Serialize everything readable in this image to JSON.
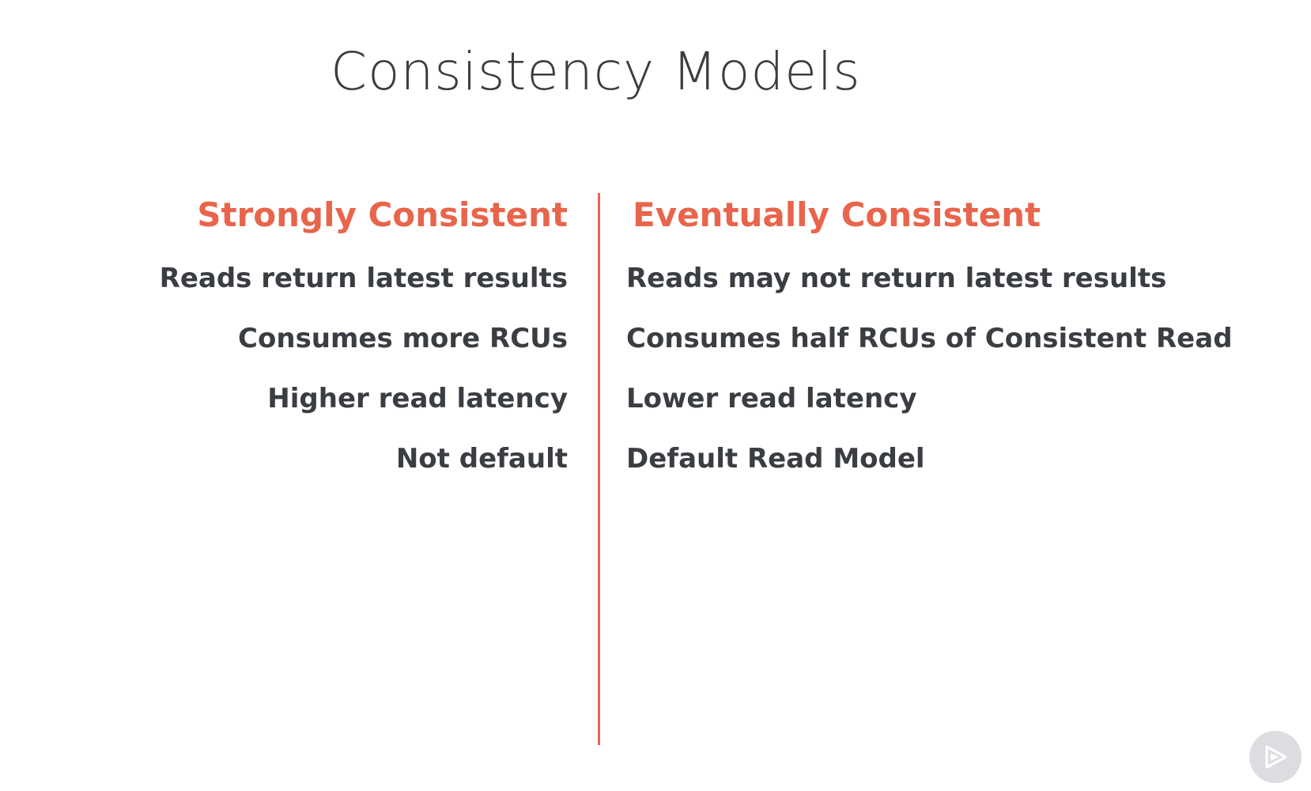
{
  "slide": {
    "title": "Consistency Models"
  },
  "left_column": {
    "heading": "Strongly Consistent",
    "items": [
      "Reads return latest results",
      "Consumes more RCUs",
      "Higher read latency",
      "Not default"
    ]
  },
  "right_column": {
    "heading": "Eventually Consistent",
    "items": [
      "Reads may not return latest results",
      "Consumes half RCUs of Consistent Read",
      "Lower read latency",
      "Default Read Model"
    ]
  },
  "colors": {
    "accent": "#e8654c",
    "text": "#3a3d42",
    "background": "#ffffff"
  },
  "icons": {
    "corner_badge": "play-icon"
  }
}
